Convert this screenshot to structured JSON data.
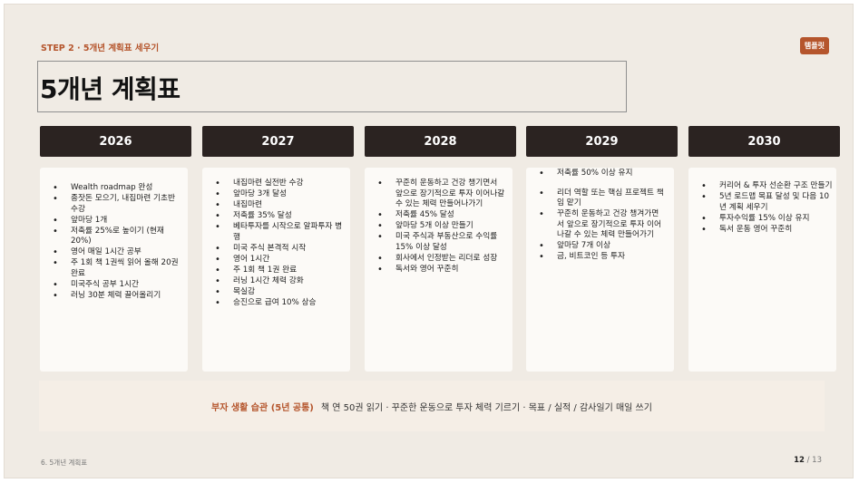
{
  "slide": {
    "step_label": "STEP 2 · 5개년 계획표 세우기",
    "brand": "템플릿",
    "title": "5개년 계획표"
  },
  "years": [
    {
      "year": "2026",
      "items": [
        "Wealth roadmap 완성",
        "종잣돈 모으기, 내집마련 기초반 수강",
        "앞마당 1개",
        "저축률 25%로 높이기 (현재 20%)",
        "영어 매일 1시간 공부",
        "주 1회 책 1권씩 읽어 올해 20권 완료",
        "미국주식 공부 1시간",
        "러닝 30분 체력 끌어올리기"
      ]
    },
    {
      "year": "2027",
      "items": [
        "내집마련 실전반 수강",
        "앞마당 3개 달성",
        "내집마련",
        "저축률 35% 달성",
        "베타투자를 시작으로 알파투자 병행",
        "미국 주식 본격적 시작",
        "영어 1시간",
        "주 1회 책 1권 완료",
        "러닝 1시간 체력 강화",
        "목실감",
        "승진으로 급여 10% 상승"
      ]
    },
    {
      "year": "2028",
      "items": [
        "꾸준히 운동하고 건강 챙기면서 앞으로 장기적으로 투자 이어나갈 수 있는 체력 만들어나가기",
        "저축률 45% 달성",
        "앞마당 5개 이상 만들기",
        "미국 주식과 부동산으로 수익률 15% 이상 달성",
        "회사에서 인정받는 리더로 성장",
        "독서와 영어 꾸준히"
      ]
    },
    {
      "year": "2029",
      "items": [
        "저축률 50% 이상 유지",
        "리더 역할 또는 핵심 프로젝트 책임 맡기",
        "꾸준히 운동하고 건강 챙겨가면서 앞으로 장기적으로 투자 이어나갈 수 있는 체력 만들어가기",
        "앞마당 7개 이상",
        "금, 비트코인 등 투자"
      ]
    },
    {
      "year": "2030",
      "items": [
        "커리어 & 투자 선순환 구조 만들기",
        "5년 로드맵 목표 달성 및 다음 10년 계획 세우기",
        "투자수익률 15% 이상 유지",
        "독서 운동 영어 꾸준히"
      ]
    }
  ],
  "habits": {
    "label": "부자 생활 습관 (5년 공통)",
    "text": "책 연 50권 읽기 · 꾸준한 운동으로 투자 체력 기르기 · 목표 / 실적 / 감사일기 매일 쓰기"
  },
  "footer": {
    "section": "6. 5개년 계획표",
    "page_current": "12",
    "page_total": "/ 13"
  },
  "colors": {
    "accent": "#b5552c",
    "header_dark": "#2b2321",
    "background": "#f0ebe4",
    "card": "#fcfaf7"
  }
}
